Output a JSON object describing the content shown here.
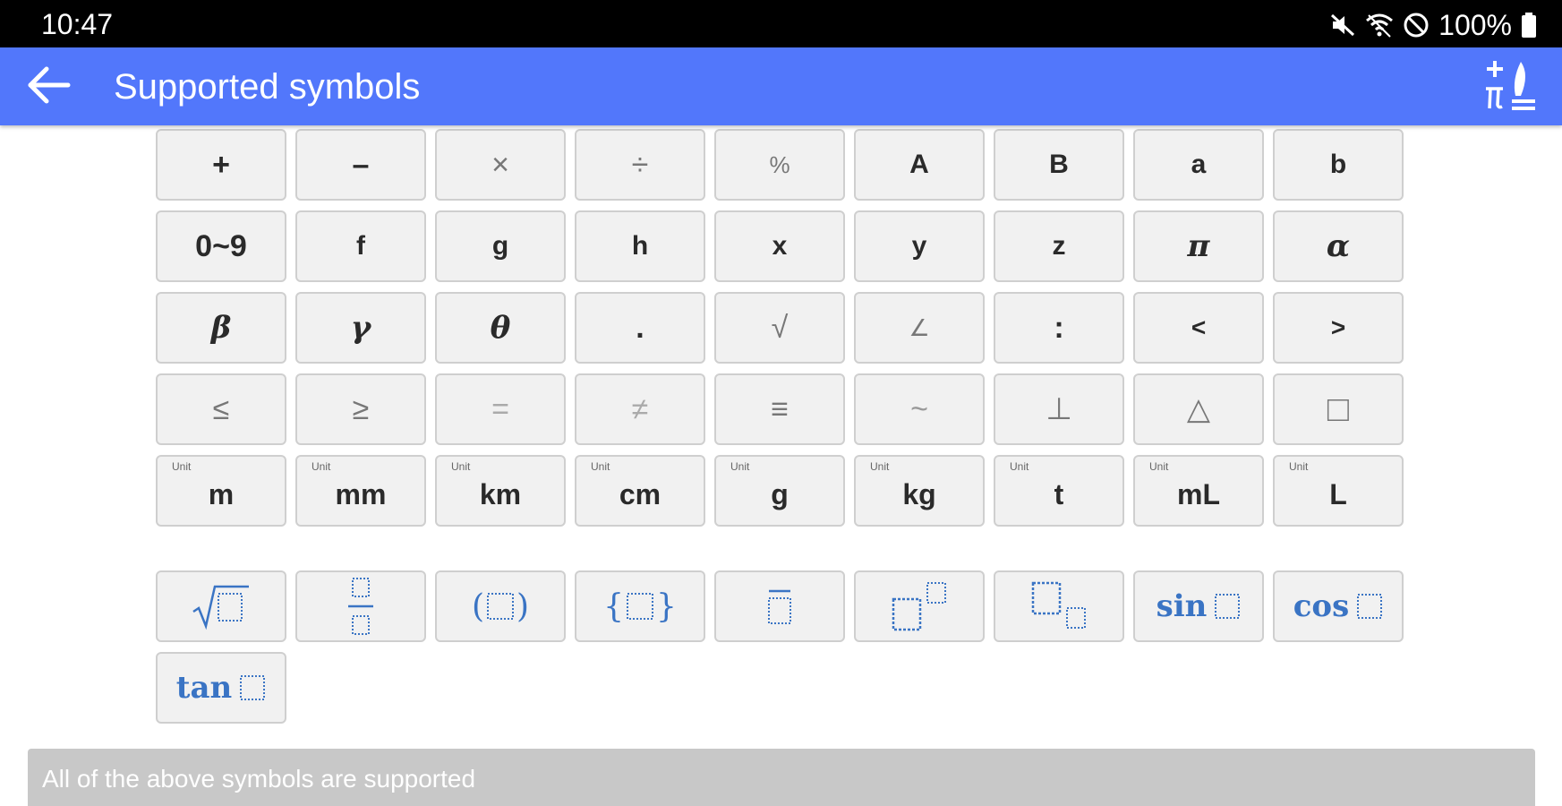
{
  "status_bar": {
    "time": "10:47",
    "battery": "100%",
    "icons": [
      "mute-icon",
      "wifi-icon",
      "do-not-disturb-icon",
      "battery-icon"
    ]
  },
  "app_bar": {
    "title": "Supported symbols",
    "back_icon": "arrow-left-icon",
    "action_icon": "math-symbols-icon",
    "accent_color": "#5277fb"
  },
  "symbols": {
    "row1": [
      "+",
      "–",
      "×",
      "÷",
      "%",
      "A",
      "B",
      "a",
      "b"
    ],
    "row2": [
      "0~9",
      "f",
      "g",
      "h",
      "x",
      "y",
      "z",
      "π",
      "α"
    ],
    "row3": [
      "β",
      "γ",
      "θ",
      ".",
      "√",
      "∠",
      ":",
      "<",
      ">"
    ],
    "row4": [
      "≤",
      "≥",
      "=",
      "≠",
      "≡",
      "~",
      "⊥",
      "△",
      "□"
    ]
  },
  "units": {
    "tag": "Unit",
    "items": [
      "m",
      "mm",
      "km",
      "cm",
      "g",
      "kg",
      "t",
      "mL",
      "L"
    ]
  },
  "templates": {
    "sin": "sin",
    "cos": "cos",
    "tan": "tan",
    "paren_open": "(",
    "paren_close": ")",
    "brace_open": "{",
    "brace_close": "}",
    "icons": [
      "sqrt-template-icon",
      "fraction-template-icon",
      "parentheses-template-icon",
      "braces-template-icon",
      "overline-template-icon",
      "superscript-template-icon",
      "subscript-template-icon",
      "sin-template-icon",
      "cos-template-icon",
      "tan-template-icon"
    ],
    "template_color": "#3a74c4"
  },
  "footer": {
    "message": "All of the above symbols are supported"
  }
}
